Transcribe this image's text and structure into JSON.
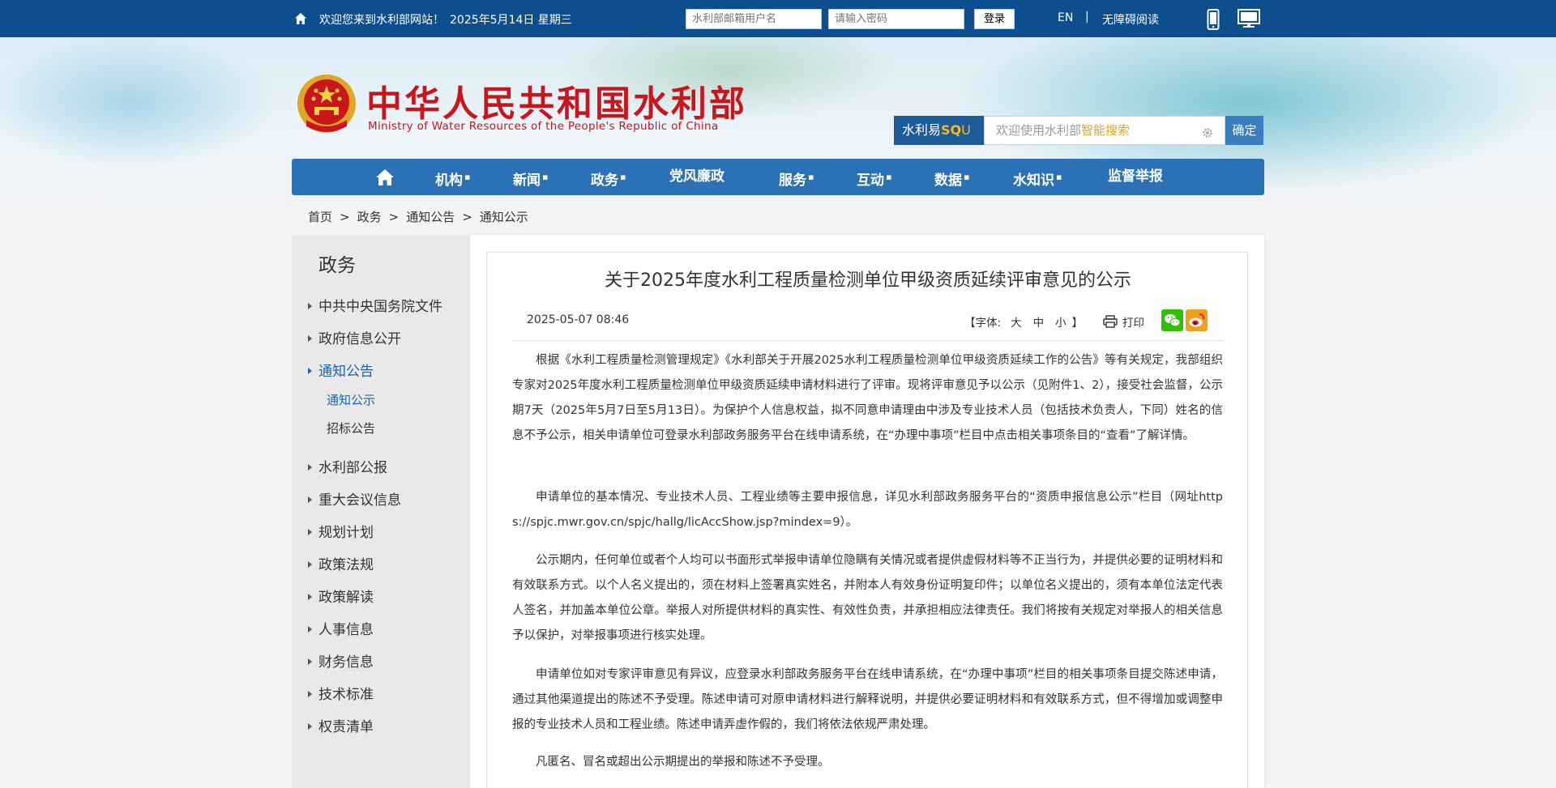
{
  "topbar": {
    "welcome": "欢迎您来到水利部网站！",
    "date": "2025年5月14日 星期三",
    "username_placeholder": "水利部邮箱用户名",
    "password_placeholder": "请输入密码",
    "login_label": "登录",
    "lang_label": "EN",
    "separator": "|",
    "accessibility_label": "无障碍阅读"
  },
  "header": {
    "title_cn": "中华人民共和国水利部",
    "title_en": "Ministry of Water Resources of the People's Republic of China"
  },
  "search": {
    "brand_prefix": "水利易",
    "brand_s": "S",
    "brand_q": "Q",
    "brand_u": "U",
    "placeholder_prefix": "欢迎使用水利部",
    "placeholder_highlight": "智能搜索",
    "button_label": "确定"
  },
  "nav": {
    "items": [
      {
        "label": "机构",
        "dot": "▪"
      },
      {
        "label": "新闻",
        "dot": "▪"
      },
      {
        "label": "政务",
        "dot": "▪"
      },
      {
        "label": "党风廉政",
        "dot": ""
      },
      {
        "label": "服务",
        "dot": "▪"
      },
      {
        "label": "互动",
        "dot": "▪"
      },
      {
        "label": "数据",
        "dot": "▪"
      },
      {
        "label": "水知识",
        "dot": "▪"
      },
      {
        "label": "监督举报",
        "dot": ""
      }
    ]
  },
  "breadcrumb": {
    "items": [
      "首页",
      "政务",
      "通知公告",
      "通知公示"
    ],
    "separator": ">"
  },
  "sidebar": {
    "title": "政务",
    "items": [
      "中共中央国务院文件",
      "政府信息公开",
      "通知公告",
      "水利部公报",
      "重大会议信息",
      "规划计划",
      "政策法规",
      "政策解读",
      "人事信息",
      "财务信息",
      "技术标准",
      "权责清单"
    ],
    "sub_items": [
      "通知公示",
      "招标公告"
    ]
  },
  "article": {
    "title": "关于2025年度水利工程质量检测单位甲级资质延续评审意见的公示",
    "date": "2025-05-07 08:46",
    "font_open": "【字体:",
    "font_sizes": [
      "大",
      "中",
      "小"
    ],
    "font_close": "】",
    "print_label": "打印",
    "paragraphs": [
      "根据《水利工程质量检测管理规定》《水利部关于开展2025水利工程质量检测单位甲级资质延续工作的公告》等有关规定，我部组织专家对2025年度水利工程质量检测单位甲级资质延续申请材料进行了评审。现将评审意见予以公示（见附件1、2），接受社会监督，公示期7天（2025年5月7日至5月13日）。为保护个人信息权益，拟不同意申请理由中涉及专业技术人员（包括技术负责人，下同）姓名的信息不予公示，相关申请单位可登录水利部政务服务平台在线申请系统，在“办理中事项”栏目中点击相关事项条目的“查看”了解详情。",
      "申请单位的基本情况、专业技术人员、工程业绩等主要申报信息，详见水利部政务服务平台的“资质申报信息公示”栏目（网址https://spjc.mwr.gov.cn/spjc/hallg/licAccShow.jsp?mindex=9）。",
      "公示期内，任何单位或者个人均可以书面形式举报申请单位隐瞒有关情况或者提供虚假材料等不正当行为，并提供必要的证明材料和有效联系方式。以个人名义提出的，须在材料上签署真实姓名，并附本人有效身份证明复印件；以单位名义提出的，须有本单位法定代表人签名，并加盖本单位公章。举报人对所提供材料的真实性、有效性负责，并承担相应法律责任。我们将按有关规定对举报人的相关信息予以保护，对举报事项进行核实处理。",
      "申请单位如对专家评审意见有异议，应登录水利部政务服务平台在线申请系统，在“办理中事项”栏目的相关事项条目提交陈述申请，通过其他渠道提出的陈述不予受理。陈述申请可对原申请材料进行解释说明，并提供必要证明材料和有效联系方式，但不得增加或调整申报的专业技术人员和工程业绩。陈述申请弄虚作假的，我们将依法依规严肃处理。",
      "凡匿名、冒名或超出公示期提出的举报和陈述不予受理。"
    ]
  },
  "icons": {
    "home": "home-icon",
    "phone": "phone-icon",
    "desktop": "desktop-icon",
    "emblem": "national-emblem-icon",
    "gear": "gear-icon",
    "print": "printer-icon",
    "wechat": "wechat-icon",
    "weibo": "weibo-icon"
  },
  "colors": {
    "topbar": "#0d4f8e",
    "nav": "#2a71b5",
    "brand_red": "#c8161d",
    "active_link": "#1d63b0",
    "search_highlight": "#e6a11f"
  }
}
